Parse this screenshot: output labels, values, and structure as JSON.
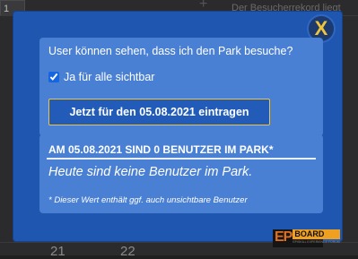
{
  "background": {
    "select_value": "1",
    "header_text": "Der Besucherrekord liegt",
    "calendar_numbers": [
      "21",
      "22"
    ]
  },
  "modal": {
    "close_label": "X",
    "visibility": {
      "question": "User können sehen, dass ich den Park besuche?",
      "checkbox_label": "Ja für alle sichtbar",
      "checkbox_checked": true,
      "register_button": "Jetzt für den 05.08.2021 eintragen"
    },
    "users": {
      "heading": "AM 05.08.2021 SIND 0 BENUTZER IM PARK*",
      "message": "Heute sind keine Benutzer im Park.",
      "footnote": "* Dieser Wert enthält ggf. auch unsichtbare Benutzer"
    }
  },
  "logo": {
    "ep": "EP",
    "board": "BOARD",
    "tagline": "EPISKILL EXPERIENCE FORUM"
  },
  "colors": {
    "modal_bg": "#1f57b0",
    "panel_bg": "#4a80d3",
    "accent_yellow": "#f0c43a",
    "logo_orange": "#e07020"
  }
}
